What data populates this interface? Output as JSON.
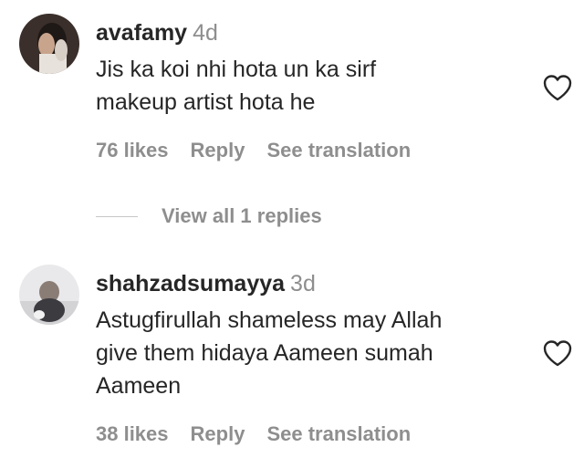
{
  "comments": [
    {
      "username": "avafamy",
      "time": "4d",
      "text_lines": [
        "Jis ka koi nhi hota un ka sirf",
        "makeup artist hota he"
      ],
      "likes": "76 likes",
      "reply": "Reply",
      "translate": "See translation",
      "view_replies": "View all 1 replies"
    },
    {
      "username": "shahzadsumayya",
      "time": "3d",
      "text_lines": [
        "Astugfirullah shameless may Allah",
        "give them hidaya Aameen sumah",
        "Aameen"
      ],
      "likes": "38 likes",
      "reply": "Reply",
      "translate": "See translation"
    }
  ],
  "icons": {
    "like": "heart-outline-icon"
  },
  "colors": {
    "primary_text": "#262626",
    "secondary_text": "#8e8e8e"
  }
}
